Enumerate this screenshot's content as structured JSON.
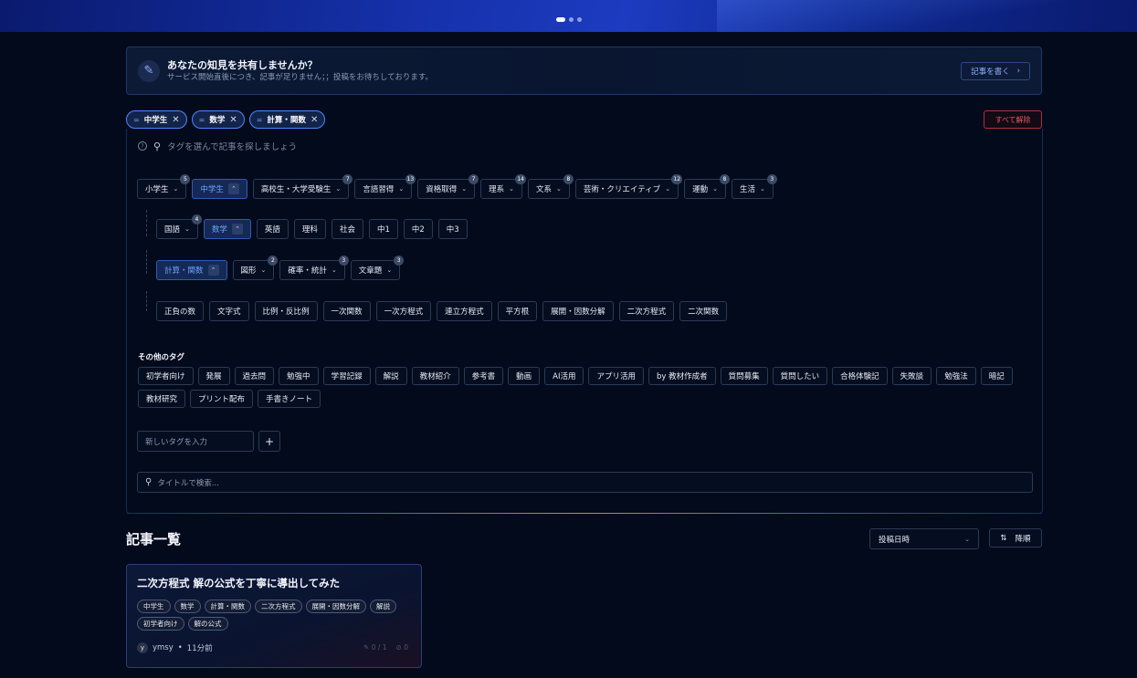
{
  "hero": {
    "slides": 3,
    "active_slide": 1
  },
  "banner": {
    "title": "あなたの知見を共有しませんか？",
    "subtitle": "サービス開始直後につき、記事が足りません；；投稿をお待ちしております。",
    "button_label": "記事を書く",
    "button_arrow": "›",
    "icon": "pencil-icon"
  },
  "selected_tags": [
    {
      "label": "中学生",
      "prefix": "=",
      "remove": "✕"
    },
    {
      "label": "数学",
      "prefix": "=",
      "remove": "✕"
    },
    {
      "label": "計算・関数",
      "prefix": "=",
      "remove": "✕"
    }
  ],
  "clear_all_label": "すべて解除",
  "tag_search": {
    "help": "?",
    "placeholder": "タグを選んで記事を探しましょう"
  },
  "level1": [
    {
      "label": "小学生",
      "badge": "5",
      "selected": false
    },
    {
      "label": "中学生",
      "badge": "",
      "selected": true
    },
    {
      "label": "高校生・大学受験生",
      "badge": "7",
      "selected": false
    },
    {
      "label": "言語習得",
      "badge": "13",
      "selected": false
    },
    {
      "label": "資格取得",
      "badge": "7",
      "selected": false
    },
    {
      "label": "理系",
      "badge": "14",
      "selected": false
    },
    {
      "label": "文系",
      "badge": "8",
      "selected": false
    },
    {
      "label": "芸術・クリエイティブ",
      "badge": "12",
      "selected": false
    },
    {
      "label": "運動",
      "badge": "8",
      "selected": false
    },
    {
      "label": "生活",
      "badge": "3",
      "selected": false
    }
  ],
  "level2": [
    {
      "label": "国語",
      "badge": "4",
      "dropdown": true,
      "selected": false
    },
    {
      "label": "数学",
      "badge": "",
      "dropdown": true,
      "selected": true
    },
    {
      "label": "英語",
      "badge": "",
      "dropdown": false,
      "selected": false
    },
    {
      "label": "理科",
      "badge": "",
      "dropdown": false,
      "selected": false
    },
    {
      "label": "社会",
      "badge": "",
      "dropdown": false,
      "selected": false
    },
    {
      "label": "中1",
      "badge": "",
      "dropdown": false,
      "selected": false
    },
    {
      "label": "中2",
      "badge": "",
      "dropdown": false,
      "selected": false
    },
    {
      "label": "中3",
      "badge": "",
      "dropdown": false,
      "selected": false
    }
  ],
  "level3": [
    {
      "label": "計算・関数",
      "badge": "",
      "selected": true
    },
    {
      "label": "図形",
      "badge": "2",
      "selected": false
    },
    {
      "label": "確率・統計",
      "badge": "3",
      "selected": false
    },
    {
      "label": "文章題",
      "badge": "3",
      "selected": false
    }
  ],
  "level4": [
    "正負の数",
    "文字式",
    "比例・反比例",
    "一次関数",
    "一次方程式",
    "連立方程式",
    "平方根",
    "展開・因数分解",
    "二次方程式",
    "二次関数"
  ],
  "other_tags_title": "その他のタグ",
  "other_tags": [
    "初学者向け",
    "発展",
    "過去問",
    "勉強中",
    "学習記録",
    "解説",
    "教材紹介",
    "参考書",
    "動画",
    "AI活用",
    "アプリ活用",
    "by 教材作成者",
    "質問募集",
    "質問したい",
    "合格体験記",
    "失敗談",
    "勉強法",
    "暗記",
    "教材研究",
    "プリント配布",
    "手書きノート"
  ],
  "new_tag": {
    "placeholder": "新しいタグを入力",
    "add_label": "+"
  },
  "title_search": {
    "placeholder": "タイトルで検索..."
  },
  "article_list": {
    "title": "記事一覧",
    "sort_label": "投稿日時",
    "order_icon": "⇅",
    "order_label": "降順"
  },
  "articles": [
    {
      "title": "二次方程式 解の公式を丁寧に導出してみた",
      "tags": [
        "中学生",
        "数学",
        "計算・関数",
        "二次方程式",
        "展開・因数分解",
        "解説",
        "初学者向け",
        "解の公式"
      ],
      "author_initial": "y",
      "author": "ymsy",
      "separator": "•",
      "time": "11分前",
      "likes": "0 / 1",
      "bookmarks": "0"
    }
  ]
}
